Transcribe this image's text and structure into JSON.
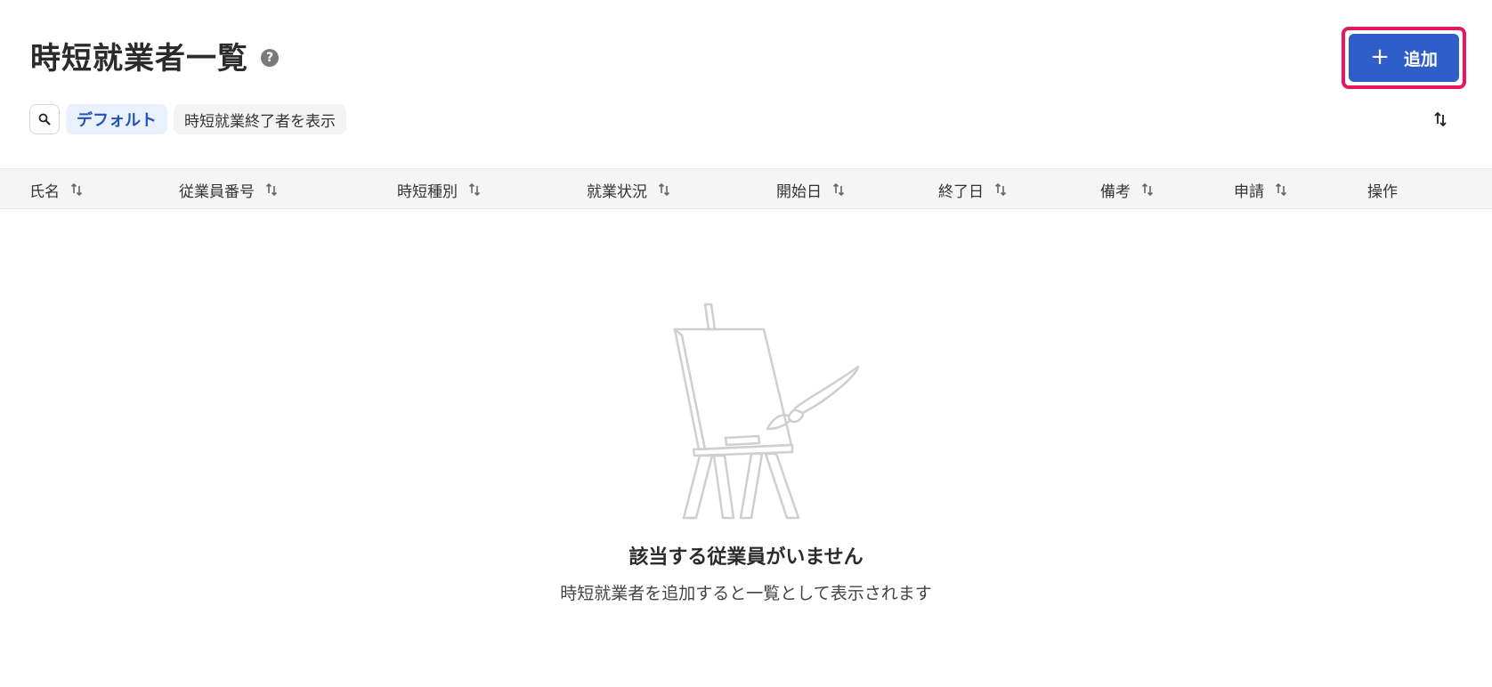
{
  "header": {
    "title": "時短就業者一覧",
    "help_icon": "?",
    "add_label": "追加"
  },
  "filters": {
    "default_label": "デフォルト",
    "show_ended_label": "時短就業終了者を表示"
  },
  "table": {
    "columns": [
      {
        "label": "氏名",
        "sortable": true
      },
      {
        "label": "従業員番号",
        "sortable": true
      },
      {
        "label": "時短種別",
        "sortable": true
      },
      {
        "label": "就業状況",
        "sortable": true
      },
      {
        "label": "開始日",
        "sortable": true
      },
      {
        "label": "終了日",
        "sortable": true
      },
      {
        "label": "備考",
        "sortable": true
      },
      {
        "label": "申請",
        "sortable": true
      },
      {
        "label": "操作",
        "sortable": false
      }
    ]
  },
  "empty_state": {
    "title": "該当する従業員がいません",
    "description": "時短就業者を追加すると一覧として表示されます"
  },
  "colors": {
    "accent": "#2e5fc9",
    "highlight": "#e8155f",
    "chip_bg": "#e8f1fc"
  }
}
